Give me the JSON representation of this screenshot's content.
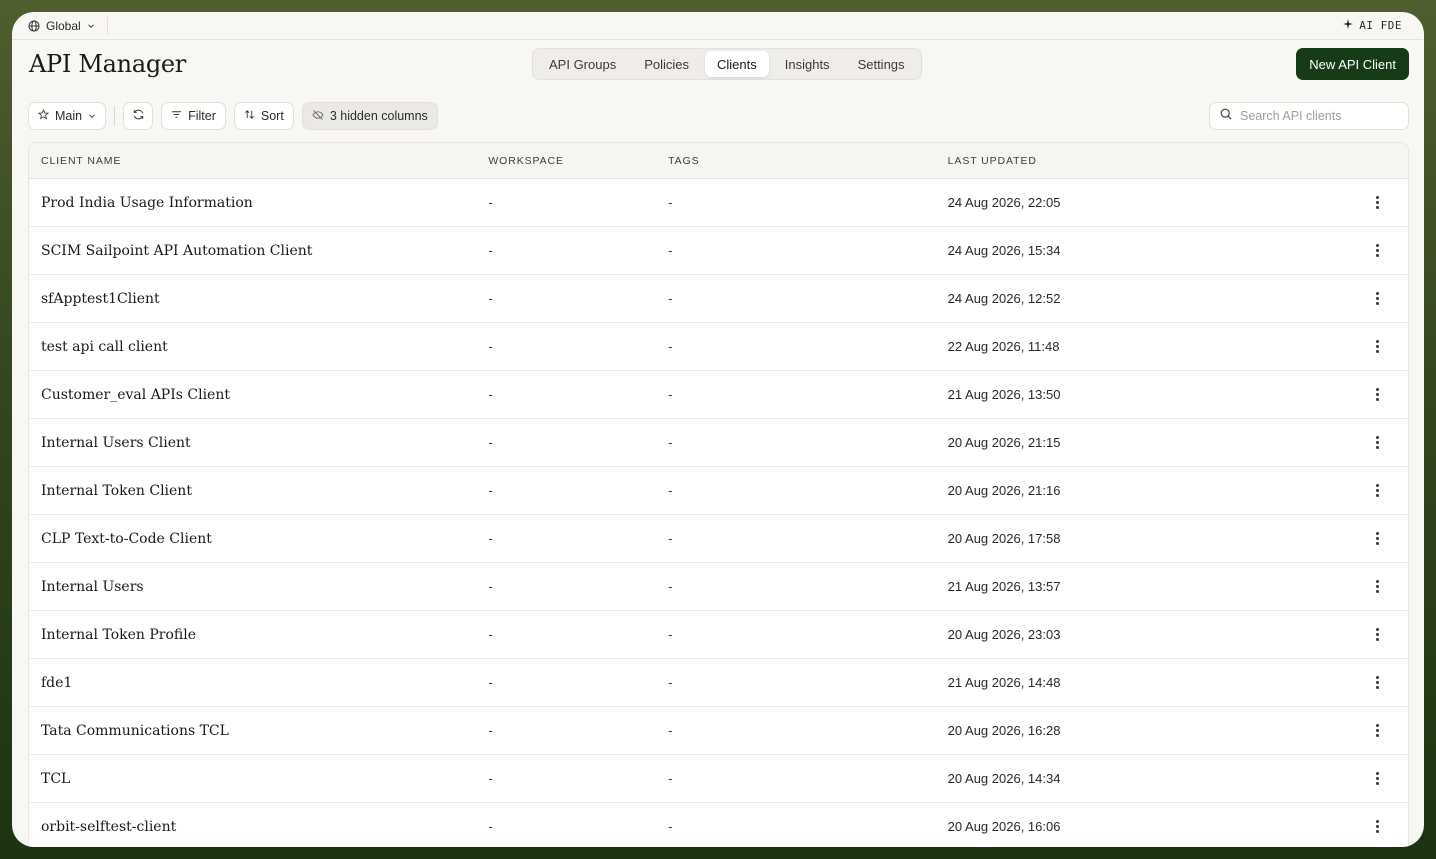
{
  "topbar": {
    "scope_label": "Global",
    "ai_label": "AI FDE"
  },
  "header": {
    "title": "API Manager",
    "tabs": [
      {
        "label": "API Groups",
        "active": false
      },
      {
        "label": "Policies",
        "active": false
      },
      {
        "label": "Clients",
        "active": true
      },
      {
        "label": "Insights",
        "active": false
      },
      {
        "label": "Settings",
        "active": false
      }
    ],
    "primary_button": "New API Client"
  },
  "toolbar": {
    "view_label": "Main",
    "filter_label": "Filter",
    "sort_label": "Sort",
    "hidden_columns_label": "3 hidden columns",
    "search_placeholder": "Search API clients"
  },
  "table": {
    "columns": [
      "CLIENT NAME",
      "WORKSPACE",
      "TAGS",
      "LAST UPDATED"
    ],
    "rows": [
      {
        "name": "Prod India Usage Information",
        "workspace": "-",
        "tags": "-",
        "updated": "24 Aug 2026, 22:05"
      },
      {
        "name": "SCIM Sailpoint API Automation Client",
        "workspace": "-",
        "tags": "-",
        "updated": "24 Aug 2026, 15:34"
      },
      {
        "name": "sfApptest1Client",
        "workspace": "-",
        "tags": "-",
        "updated": "24 Aug 2026, 12:52"
      },
      {
        "name": "test api call client",
        "workspace": "-",
        "tags": "-",
        "updated": "22 Aug 2026, 11:48"
      },
      {
        "name": "Customer_eval APIs Client",
        "workspace": "-",
        "tags": "-",
        "updated": "21 Aug 2026, 13:50"
      },
      {
        "name": "Internal Users Client",
        "workspace": "-",
        "tags": "-",
        "updated": "20 Aug 2026, 21:15"
      },
      {
        "name": "Internal Token Client",
        "workspace": "-",
        "tags": "-",
        "updated": "20 Aug 2026, 21:16"
      },
      {
        "name": "CLP Text-to-Code Client",
        "workspace": "-",
        "tags": "-",
        "updated": "20 Aug 2026, 17:58"
      },
      {
        "name": "Internal Users",
        "workspace": "-",
        "tags": "-",
        "updated": "21 Aug 2026, 13:57"
      },
      {
        "name": "Internal Token Profile",
        "workspace": "-",
        "tags": "-",
        "updated": "20 Aug 2026, 23:03"
      },
      {
        "name": "fde1",
        "workspace": "-",
        "tags": "-",
        "updated": "21 Aug 2026, 14:48"
      },
      {
        "name": "Tata Communications TCL",
        "workspace": "-",
        "tags": "-",
        "updated": "20 Aug 2026, 16:28"
      },
      {
        "name": "TCL",
        "workspace": "-",
        "tags": "-",
        "updated": "20 Aug 2026, 14:34"
      },
      {
        "name": "orbit-selftest-client",
        "workspace": "-",
        "tags": "-",
        "updated": "20 Aug 2026, 16:06"
      }
    ]
  },
  "icons": [
    "globe-icon",
    "chevron-down-icon",
    "sparkle-icon",
    "star-icon",
    "refresh-icon",
    "filter-icon",
    "sort-icon",
    "eye-off-icon",
    "search-icon",
    "more-vertical-icon"
  ],
  "colors": {
    "primary": "#173a17",
    "background": "#f8f7f4",
    "frame": "#34461f"
  }
}
